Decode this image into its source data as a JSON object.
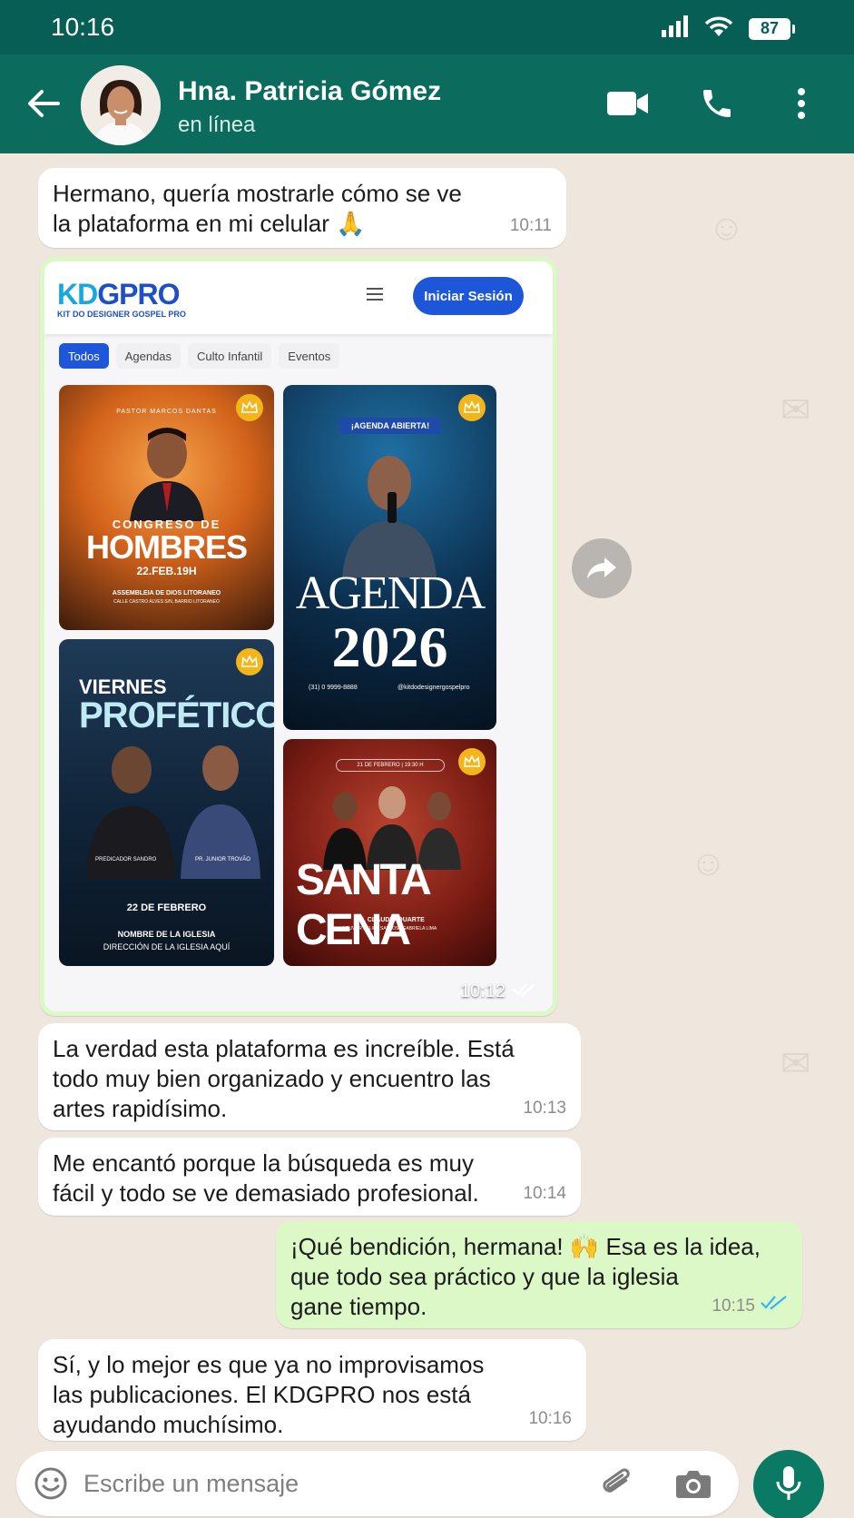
{
  "status_bar": {
    "time": "10:16",
    "battery": "87"
  },
  "header": {
    "name": "Hna. Patricia Gómez",
    "status": "en línea"
  },
  "messages": [
    {
      "text": "Hermano, quería mostrarle cómo se ve\nla plataforma en mi celular 🙏",
      "time": "10:11"
    },
    {
      "time": "10:12"
    },
    {
      "text": "La verdad esta plataforma es increíble. Está\ntodo muy bien organizado y encuentro las\nartes rapidísimo.",
      "time": "10:13"
    },
    {
      "text": "Me encantó porque la búsqueda es muy\nfácil y todo se ve demasiado profesional.",
      "time": "10:14"
    },
    {
      "text": "¡Qué bendición, hermana! 🙌 Esa es la idea,\nque todo sea práctico y que la iglesia\ngane tiempo.",
      "time": "10:15"
    },
    {
      "text": "Sí, y lo mejor es que ya no improvisamos\nlas publicaciones. El KDGPRO nos está\nayudando muchísimo.",
      "time": "10:16"
    }
  ],
  "shared_image": {
    "logo_main_1": "KD",
    "logo_main_2": "GPRO",
    "logo_sub": "KIT DO DESIGNER GOSPEL PRO",
    "login_label": "Iniciar Sesión",
    "tabs": [
      "Todos",
      "Agendas",
      "Culto Infantil",
      "Eventos"
    ],
    "cards": {
      "hombres": {
        "top": "PASTOR MARCOS DANTAS",
        "sub": "CONGRESO DE",
        "title": "HOMBRES",
        "date": "22.FEB.19H",
        "place": "ASSEMBLEIA DE DIOS LITORANEO",
        "address": "CALLE CASTRO ALVES S/N, BARRIO LITORANEO"
      },
      "agenda": {
        "badge": "¡AGENDA ABIERTA!",
        "title": "AGENDA",
        "year": "2026",
        "phone": "(31) 0 9999-8888",
        "handle": "@kitdodesignergospelpro"
      },
      "viernes": {
        "sub": "VIERNES",
        "title": "PROFÉTICO",
        "left_name": "PREDICADOR SANDRO",
        "right_name": "PR. JUNIOR TROVÃO",
        "date": "22 DE FEBRERO",
        "church": "NOMBRE DE LA IGLESIA",
        "address": "DIRECCIÓN DE LA IGLESIA AQUÍ"
      },
      "santa": {
        "date": "21 DE FEBRERO | 19:30 H",
        "title": "SANTA CENA",
        "pastor": "PR. CLÁUDIO DUARTE",
        "singers": "LOUVOR FELIPE SANTOS | GABRIELA LIMA"
      }
    }
  },
  "composer": {
    "placeholder": "Escribe un mensaje"
  },
  "colors": {
    "header": "#075e54",
    "outgoing_bubble": "#dcf8c6",
    "read_tick": "#34b7f1",
    "mic_button": "#0b7a64",
    "brand_blue": "#1e56d9"
  },
  "icons": [
    "back-arrow-icon",
    "video-call-icon",
    "phone-icon",
    "more-vert-icon",
    "forward-icon",
    "emoji-icon",
    "attach-icon",
    "camera-icon",
    "mic-icon",
    "double-check-icon",
    "crown-icon",
    "menu-icon",
    "signal-icon",
    "wifi-icon"
  ]
}
